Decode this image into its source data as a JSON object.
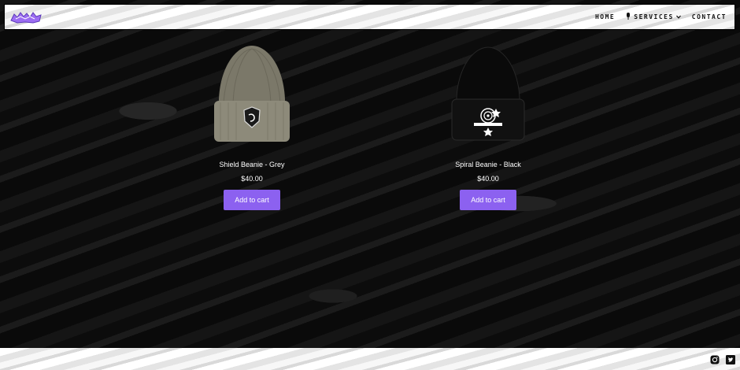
{
  "header": {
    "logo_icon": "brand-logo",
    "nav": [
      {
        "label": "HOME"
      },
      {
        "label": "SERVICES",
        "icon": "microphone-icon",
        "has_dropdown": true
      },
      {
        "label": "CONTACT"
      }
    ]
  },
  "products": [
    {
      "title": "Shield Beanie - Grey",
      "price": "$40.00",
      "button": "Add to cart",
      "image": "grey-beanie"
    },
    {
      "title": "Spiral Beanie - Black",
      "price": "$40.00",
      "button": "Add to cart",
      "image": "black-beanie"
    }
  ],
  "footer": {
    "social": [
      "instagram-icon",
      "twitter-icon"
    ]
  },
  "colors": {
    "accent": "#8c61f0",
    "background": "#111111",
    "header_bg": "#f2f2f2"
  }
}
